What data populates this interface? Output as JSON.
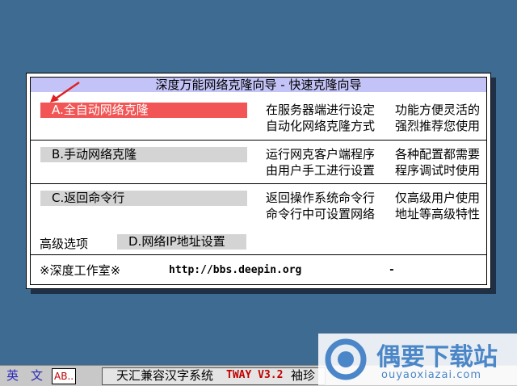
{
  "dialog": {
    "title": "深度万能网络克隆向导 - 快速克隆向导",
    "options": [
      {
        "label": "A.全自动网络克隆",
        "desc1": "在服务器端进行设定",
        "desc2": "自动化网络克隆方式",
        "desc3": "功能方便灵活的",
        "desc4": "强烈推荐您使用"
      },
      {
        "label": "B.手动网络克隆",
        "desc1": "运行网克客户端程序",
        "desc2": "由用户手工进行设置",
        "desc3": "各种配置都需要",
        "desc4": "程序调试时使用"
      },
      {
        "label": "C.返回命令行",
        "desc1": "返回操作系统命令行",
        "desc2": "命令行中可设置网络",
        "desc3": "仅高级用户使用",
        "desc4": "地址等高级特性"
      }
    ],
    "advanced_label": "高级选项",
    "advanced_option": "D.网络IP地址设置",
    "footer_studio": "※深度工作室※",
    "footer_url": "http://bbs.deepin.org",
    "footer_dash": "-"
  },
  "taskbar": {
    "lang1": "英",
    "lang2": "文",
    "mode": "AB..",
    "system": "天汇兼容汉字系统",
    "version": "TWAY V3.2",
    "font": "袖珍"
  },
  "watermark": {
    "brand": "偶要下载站",
    "domain": "ouyaoxiazai.com"
  },
  "colors": {
    "background": "#3d6b92",
    "title_bar": "#c3c3f7",
    "selected": "#f25555",
    "option": "#d4d4d4"
  }
}
